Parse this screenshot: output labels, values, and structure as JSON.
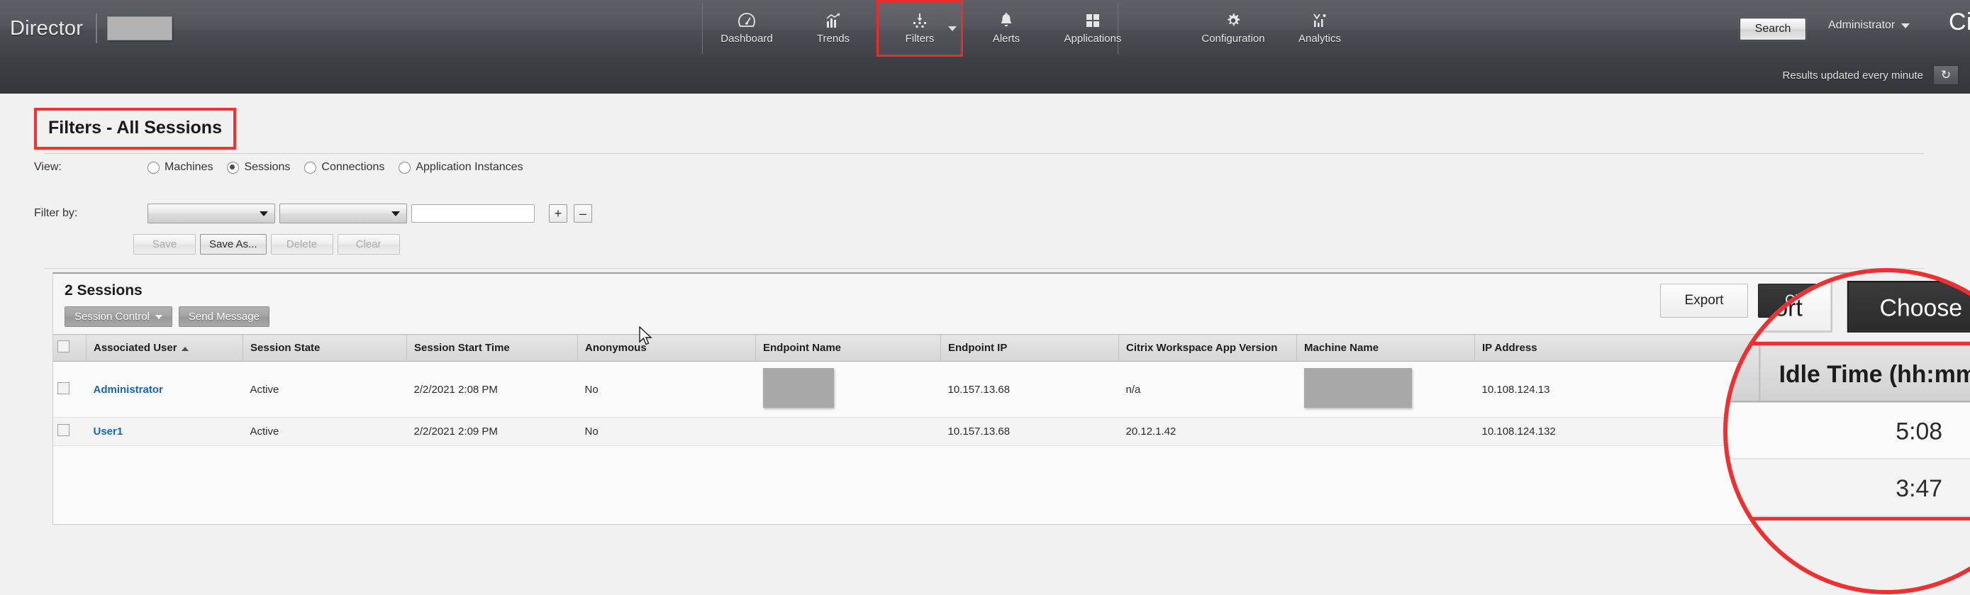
{
  "header": {
    "brand": "Director",
    "brand_redacted": true,
    "nav_items": [
      {
        "label": "Dashboard",
        "icon": "dashboard-gauge-icon",
        "highlighted": false,
        "has_caret": false
      },
      {
        "label": "Trends",
        "icon": "trends-chart-icon",
        "highlighted": false,
        "has_caret": false
      },
      {
        "label": "Filters",
        "icon": "filters-funnel-icon",
        "highlighted": true,
        "has_caret": true
      },
      {
        "label": "Alerts",
        "icon": "alerts-bell-icon",
        "highlighted": false,
        "has_caret": false
      },
      {
        "label": "Applications",
        "icon": "applications-grid-icon",
        "highlighted": false,
        "has_caret": false
      },
      {
        "label": "Configuration",
        "icon": "configuration-gear-icon",
        "highlighted": false,
        "has_caret": false
      },
      {
        "label": "Analytics",
        "icon": "analytics-chart-icon",
        "highlighted": false,
        "has_caret": false
      }
    ],
    "search_label": "Search",
    "admin_label": "Administrator",
    "citrix_logo": "Ci"
  },
  "subbar": {
    "results_text": "Results updated every minute",
    "refresh_icon": "refresh-icon",
    "refresh_glyph": "↻"
  },
  "filters": {
    "page_title": "Filters - All Sessions",
    "view_label": "View:",
    "view_options": [
      {
        "label": "Machines",
        "selected": false
      },
      {
        "label": "Sessions",
        "selected": true
      },
      {
        "label": "Connections",
        "selected": false
      },
      {
        "label": "Application Instances",
        "selected": false
      }
    ],
    "filter_by_label": "Filter by:",
    "criteria_value": "",
    "operator_value": "",
    "value_input": "",
    "add_button": "+",
    "remove_button": "–",
    "buttons": [
      {
        "label": "Save",
        "enabled": false
      },
      {
        "label": "Save As...",
        "enabled": true
      },
      {
        "label": "Delete",
        "enabled": false
      },
      {
        "label": "Clear",
        "enabled": false
      }
    ]
  },
  "sessions": {
    "title": "2 Sessions",
    "session_control_label": "Session Control",
    "send_message_label": "Send Message",
    "export_label": "Export",
    "choose_label": "Choose",
    "columns": [
      "Associated User",
      "Session State",
      "Session Start Time",
      "Anonymous",
      "Endpoint Name",
      "Endpoint IP",
      "Citrix Workspace App Version",
      "Machine Name",
      "IP Address"
    ],
    "sorted_column": "Associated User",
    "sort_direction": "asc",
    "rows": [
      {
        "checked": false,
        "associated_user": "Administrator",
        "session_state": "Active",
        "session_start_time": "2/2/2021 2:08 PM",
        "anonymous": "No",
        "endpoint_name": "",
        "endpoint_ip": "10.157.13.68",
        "workspace_app_version": "n/a",
        "machine_name": "",
        "ip_address": "10.108.124.13"
      },
      {
        "checked": false,
        "associated_user": "User1",
        "session_state": "Active",
        "session_start_time": "2/2/2021 2:09 PM",
        "anonymous": "No",
        "endpoint_name": "",
        "endpoint_ip": "10.157.13.68",
        "workspace_app_version": "20.12.1.42",
        "machine_name": "",
        "ip_address": "10.108.124.132"
      }
    ]
  },
  "callout": {
    "export_label": "Export",
    "choose_label": "Choose",
    "idle_column_header": "Idle Time (hh:mm)",
    "idle_values": [
      "5:08",
      "3:47"
    ],
    "ring_color": "#f03030",
    "highlight_color": "#f03030"
  }
}
